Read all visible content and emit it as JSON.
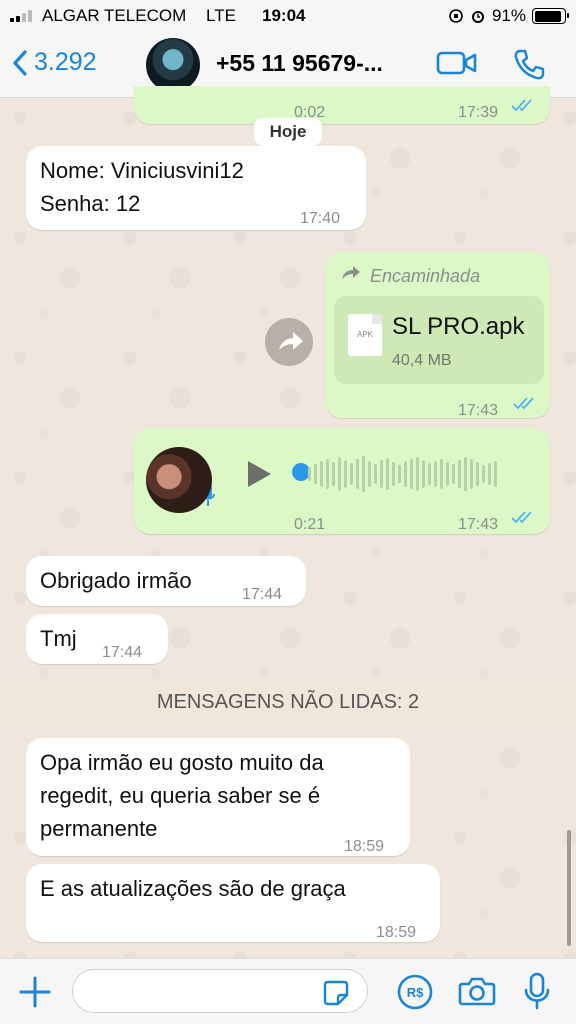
{
  "status_bar": {
    "carrier": "ALGAR TELECOM",
    "network": "LTE",
    "time": "19:04",
    "battery": "91%",
    "battery_level": 0.91
  },
  "header": {
    "back_count": "3.292",
    "contact_name": "+55 11 95679-...",
    "accent_color": "#1a84d6"
  },
  "messages": {
    "prev_audio": {
      "duration": "0:02",
      "time": "17:39"
    },
    "date_chip": "Hoje",
    "m1": {
      "line1": "Nome: Viniciusvini12",
      "line2": "Senha: 12",
      "time": "17:40"
    },
    "file": {
      "forwarded_label": "Encaminhada",
      "file_name": "SL PRO.apk",
      "file_icon_text": "APK",
      "file_size": "40,4 MB",
      "time": "17:43"
    },
    "voice": {
      "duration": "0:21",
      "time": "17:43"
    },
    "m2": {
      "text": "Obrigado irmão",
      "time": "17:44"
    },
    "m3": {
      "text": "Tmj",
      "time": "17:44"
    },
    "unread_banner": "MENSAGENS NÃO LIDAS: 2",
    "m4": {
      "line1": "Opa irmão eu gosto muito da",
      "line2": "regedit, eu queria saber se é",
      "line3": "permanente",
      "time": "18:59"
    },
    "m5": {
      "text": "E as atualizações são de graça",
      "time": "18:59"
    }
  },
  "bottom_bar": {
    "input_placeholder": "",
    "icons": [
      "plus-icon",
      "sticker-icon",
      "pix-icon",
      "camera-icon",
      "microphone-icon"
    ]
  },
  "colors": {
    "outgoing_bubble": "#dcf8c6",
    "incoming_bubble": "#ffffff",
    "read_ticks": "#4fb3f6"
  }
}
